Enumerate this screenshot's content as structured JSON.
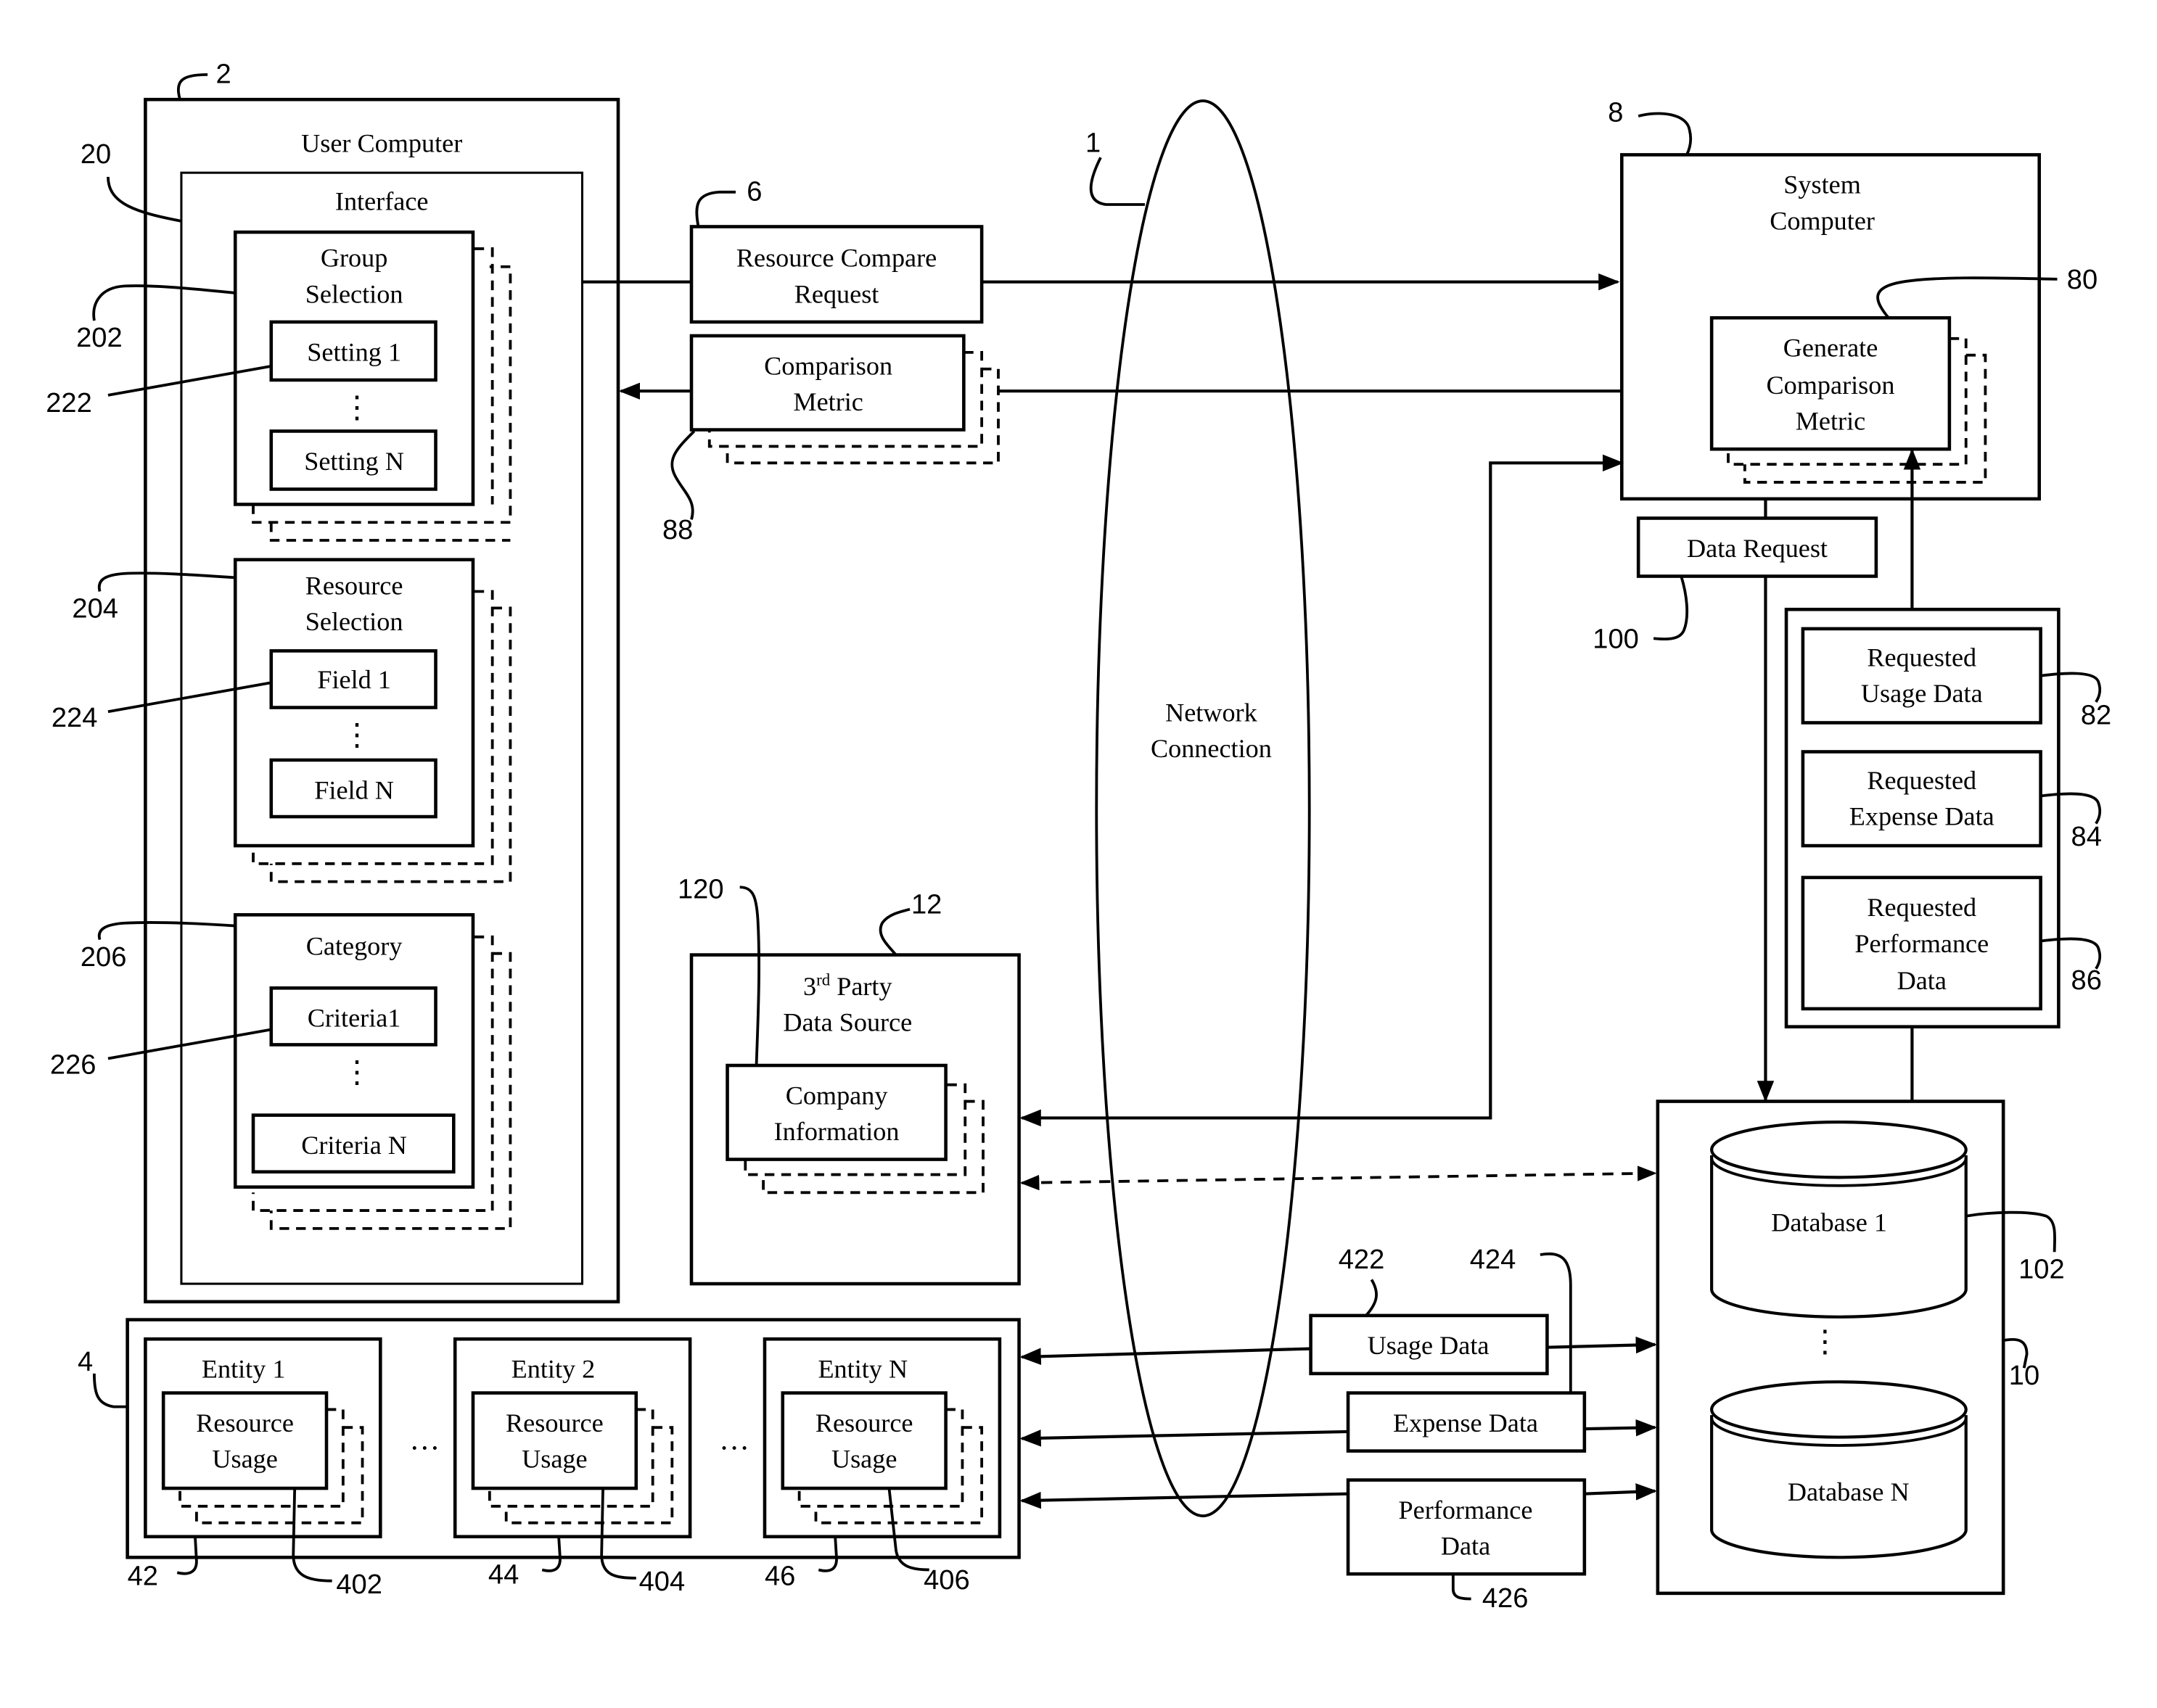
{
  "diagram": {
    "user_computer": {
      "title": "User Computer",
      "ref": "2",
      "interface": {
        "title": "Interface",
        "ref": "20",
        "group_selection": {
          "title_line1": "Group",
          "title_line2": "Selection",
          "ref": "202",
          "item_first": "Setting 1",
          "item_last": "Setting N",
          "item_ref": "222"
        },
        "resource_selection": {
          "title_line1": "Resource",
          "title_line2": "Selection",
          "ref": "204",
          "item_first": "Field 1",
          "item_last": "Field N",
          "item_ref": "224"
        },
        "category": {
          "title": "Category",
          "ref": "206",
          "item_first": "Criteria1",
          "item_last": "Criteria N",
          "item_ref": "226"
        }
      }
    },
    "resource_compare_request": {
      "line1": "Resource Compare",
      "line2": "Request",
      "ref": "6"
    },
    "comparison_metric": {
      "line1": "Comparison",
      "line2": "Metric",
      "ref": "88"
    },
    "network": {
      "line1": "Network",
      "line2": "Connection",
      "ref": "1"
    },
    "system_computer": {
      "line1": "System",
      "line2": "Computer",
      "ref": "8",
      "generate": {
        "line1": "Generate",
        "line2": "Comparison",
        "line3": "Metric",
        "ref": "80"
      }
    },
    "data_request": {
      "label": "Data Request",
      "ref": "100"
    },
    "requested": [
      {
        "line1": "Requested",
        "line2": "Usage Data",
        "line3": "",
        "ref": "82"
      },
      {
        "line1": "Requested",
        "line2": "Expense Data",
        "line3": "",
        "ref": "84"
      },
      {
        "line1": "Requested",
        "line2": "Performance",
        "line3": "Data",
        "ref": "86"
      }
    ],
    "third_party": {
      "line1_prefix": "3",
      "line1_sup": "rd",
      "line1_suffix": " Party",
      "line2": "Data Source",
      "ref": "12",
      "company": {
        "line1": "Company",
        "line2": "Information",
        "ref": "120"
      }
    },
    "entities_group": {
      "ref": "4",
      "ellipsis": "…",
      "entities": [
        {
          "title": "Entity 1",
          "usage_line1": "Resource",
          "usage_line2": "Usage",
          "ref": "42",
          "usage_ref": "402"
        },
        {
          "title": "Entity 2",
          "usage_line1": "Resource",
          "usage_line2": "Usage",
          "ref": "44",
          "usage_ref": "404"
        },
        {
          "title": "Entity N",
          "usage_line1": "Resource",
          "usage_line2": "Usage",
          "ref": "46",
          "usage_ref": "406"
        }
      ]
    },
    "transfers": {
      "usage": {
        "label": "Usage Data",
        "ref": "422"
      },
      "expense": {
        "label": "Expense Data",
        "ref": "424"
      },
      "performance": {
        "line1": "Performance",
        "line2": "Data",
        "ref": "426"
      }
    },
    "databases": {
      "ref": "10",
      "db_first": {
        "label": "Database 1",
        "ref": "102"
      },
      "db_last": {
        "label": "Database N"
      }
    },
    "vertical_ellipsis": "⋮"
  }
}
